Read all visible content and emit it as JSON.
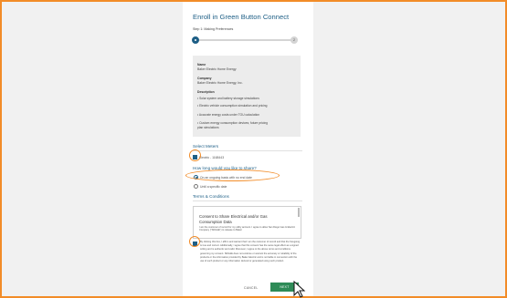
{
  "enroll": {
    "title": "Enroll in Green Button Connect",
    "step_label": "Step 1: Making Preferences",
    "progress_end": "2"
  },
  "info": {
    "name_label": "Name",
    "name_value": "Baker Electric Home Energy",
    "company_label": "Company",
    "company_value": "Baker Electric Home Energy, Inc.",
    "description_label": "Description",
    "bullets": [
      "• Solar system and battery storage simulations",
      "• Electric vehicle consumption simulation and pricing",
      "• Accurate energy costs under TOU calculation",
      "• Custom energy consumption devices; future pricing",
      "  plan simulations"
    ]
  },
  "meters": {
    "heading": "Select Meters",
    "meter_label": "Electric - 1168443"
  },
  "share": {
    "heading": "How long would you like to share?",
    "option_ongoing": "On an ongoing basis with no end date",
    "option_until": "Until a specific date"
  },
  "terms": {
    "heading": "Terms & Conditions",
    "consent_title_1": "Consent to Share Electrical and/or Gas",
    "consent_title_2": "Consumption Data",
    "consent_body": "I am the customer of record for my utility account. I agree to allow San Diego Gas & Electric Company (\"SDG&E\") to release to Baker",
    "agree_text": "By clicking this box, I affirm and warrant that I am the customer of record and that the foregoing is true and correct. Additionally, I agree that this consent has the same legal effect as a signed writing and is authentic and valid. Moreover, I agree to the above terms and conditions governing my consent. SDG&E does not endorse or warrant the accuracy or reliability of the products or the information provided by Baker Electric and is not liable in connection with the use of such product or any information derived or generated using such product."
  },
  "actions": {
    "cancel": "CANCEL",
    "next": "NEXT"
  },
  "colors": {
    "accent": "#1e5f86",
    "highlight": "#f28c28",
    "next_button": "#2e8b57"
  }
}
